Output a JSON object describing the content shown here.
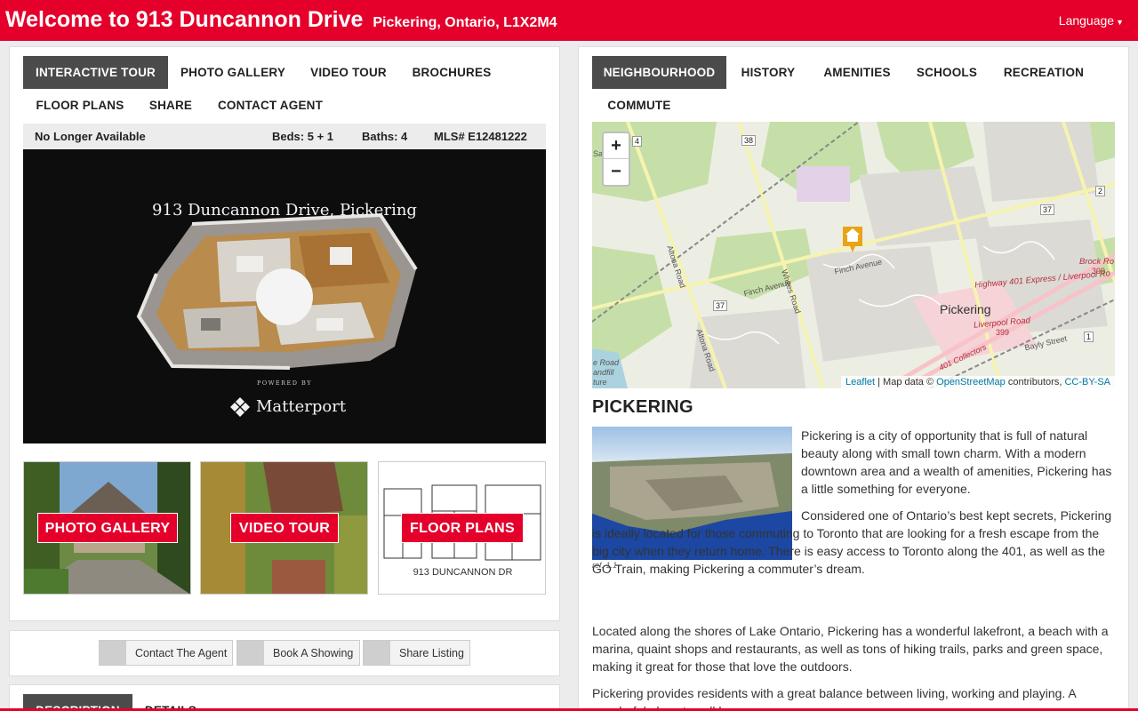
{
  "header": {
    "title": "Welcome to 913 Duncannon Drive",
    "subtitle": "Pickering, Ontario, L1X2M4",
    "language_label": "Language"
  },
  "left_tabs": [
    {
      "label": "INTERACTIVE TOUR",
      "active": true
    },
    {
      "label": "PHOTO GALLERY",
      "active": false
    },
    {
      "label": "VIDEO TOUR",
      "active": false
    },
    {
      "label": "BROCHURES",
      "active": false
    },
    {
      "label": "FLOOR PLANS",
      "active": false
    },
    {
      "label": "SHARE",
      "active": false
    },
    {
      "label": "CONTACT AGENT",
      "active": false
    }
  ],
  "listing": {
    "status": "No Longer Available",
    "beds": "Beds: 5 + 1",
    "baths": "Baths: 4",
    "mls": "MLS# E12481222"
  },
  "tour": {
    "title": "913 Duncannon Drive, Pickering",
    "play_icon": "",
    "powered_by": "POWERED BY",
    "brand": "Matterport"
  },
  "thumbs": [
    {
      "label": "PHOTO GALLERY"
    },
    {
      "label": "VIDEO TOUR"
    },
    {
      "label": "FLOOR PLANS",
      "caption": "913 DUNCANNON DR"
    }
  ],
  "actions": [
    {
      "label": "Contact The Agent",
      "icon": ""
    },
    {
      "label": "Book A Showing",
      "icon": ""
    },
    {
      "label": "Share Listing",
      "icon": ""
    }
  ],
  "bottom_tabs": [
    {
      "label": "DESCRIPTION",
      "active": true
    },
    {
      "label": "DETAILS",
      "active": false
    }
  ],
  "right_tabs": [
    {
      "label": "NEIGHBOURHOOD",
      "active": true
    },
    {
      "label": "HISTORY",
      "active": false
    },
    {
      "label": "AMENITIES",
      "active": false
    },
    {
      "label": "SCHOOLS",
      "active": false
    },
    {
      "label": "RECREATION",
      "active": false
    },
    {
      "label": "COMMUTE",
      "active": false
    }
  ],
  "map": {
    "zoom_in": "+",
    "zoom_out": "−",
    "attribution": {
      "leaflet": "Leaflet",
      "sep": " | Map data © ",
      "osm": "OpenStreetMap",
      "contrib": " contributors, ",
      "license": "CC-BY-SA"
    },
    "labels": {
      "pickering": "Pickering",
      "finch1": "Finch Avenue",
      "finch2": "Finch Avenue",
      "altona1": "Altona Road",
      "altona2": "Altona Road",
      "whites": "Whites Road",
      "hwy401": "Highway 401 Express / Liverpool Ro",
      "brock": "Brock Ro",
      "liverpool": "Liverpool Road",
      "bayly": "Bayly Street",
      "collectors": "401 Collectors",
      "r38": "38",
      "r37a": "37",
      "r37b": "37",
      "r4": "4",
      "r2": "2",
      "r1": "1",
      "r399a": "399",
      "r399b": "399",
      "landfill1": "e Road",
      "landfill2": "andfill",
      "landfill3": "ture",
      "sad": "Sad"
    }
  },
  "neighbourhood": {
    "heading": "PICKERING",
    "image_ref": "ref. 1.1",
    "p1": "Pickering is a city of opportunity that is full of natural beauty along with small town charm. With a modern downtown area and a wealth of amenities, Pickering has a little something for everyone.",
    "p2": "Considered one of Ontario’s best kept secrets, Pickering is ideally located for those commuting to Toronto that are looking for a fresh escape from the big city when they return home. There is easy access to Toronto along the 401, as well as the GO Train, making Pickering a commuter’s dream.",
    "p3": "Located along the shores of Lake Ontario, Pickering has a wonderful lakefront, a beach with a marina, quaint shops and restaurants, as well as tons of hiking trails, parks and green space, making it great for those that love the outdoors.",
    "p4": "Pickering provides residents with a great balance between living, working and playing. A wonderful place to call home."
  },
  "colors": {
    "brand_red": "#e4002b",
    "tab_active": "#4b4b4b",
    "link": "#0078a8"
  }
}
